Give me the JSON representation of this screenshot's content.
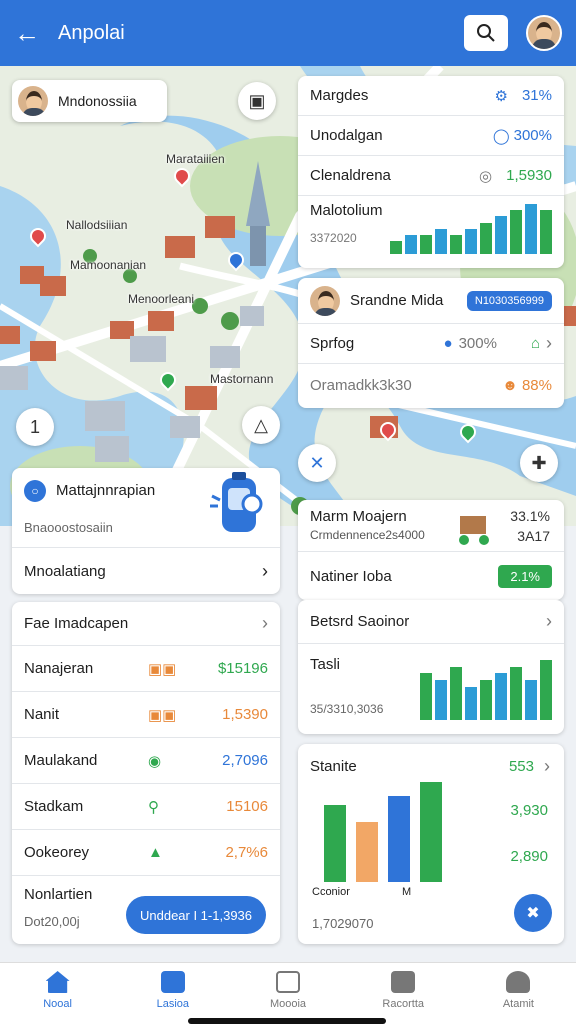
{
  "header": {
    "title": "Anpolai"
  },
  "location_chip": {
    "name": "Mndonossiia"
  },
  "map": {
    "labels": [
      "Marataiiien",
      "Nallodsiiian",
      "Mamoonanian",
      "Menoorleani",
      "Mastornann"
    ],
    "badge_left": "1"
  },
  "stats_card": {
    "rows": [
      {
        "label": "Margdes",
        "value": "31%"
      },
      {
        "label": "Unodalgan",
        "value": "300%"
      },
      {
        "label": "Clenaldrena",
        "value": "1,5930"
      },
      {
        "label": "Malotolium",
        "sub": "3372020"
      }
    ]
  },
  "profile_card": {
    "name": "Srandne Mida",
    "pill": "N1030356999",
    "row1_label": "Sprfog",
    "row1_value": "300%",
    "row2_label": "Oramadkk3k30",
    "row2_value": "88%"
  },
  "route_card": {
    "title": "Mattajnnrapian",
    "subtitle": "Bnaooostosaiin",
    "action": "Mnoalatiang"
  },
  "mid_card": {
    "title": "Marm Moajern",
    "sub": "Crmdennence2s4000",
    "v1": "33.1%",
    "v2": "3A17",
    "row_label": "Natiner Ioba",
    "row_badge": "2.1%"
  },
  "list_card": {
    "header": "Fae Imadcapen",
    "items": [
      {
        "label": "Nanajeran",
        "value": "$15196"
      },
      {
        "label": "Nanit",
        "value": "1,5390"
      },
      {
        "label": "Maulakand",
        "value": "2,7096"
      },
      {
        "label": "Stadkam",
        "value": "15106"
      },
      {
        "label": "Ookeorey",
        "value": "2,7%6"
      }
    ],
    "footer_label": "Nonlartien",
    "footer_sub": "Dot20,00j",
    "footer_button": "Unddear I 1-1,3936"
  },
  "sector_card": {
    "title": "Betsrd Saoinor",
    "label": "Tasli",
    "sub": "35/3310,3036"
  },
  "statis_card": {
    "title": "Stanite",
    "count": "553",
    "v1": "3,930",
    "v2": "2,890",
    "legend1": "Cconior",
    "legend2": "M",
    "footer": "1,7029070"
  },
  "nav": [
    {
      "label": "Nooal"
    },
    {
      "label": "Lasioa"
    },
    {
      "label": "Moooia"
    },
    {
      "label": "Racortta"
    },
    {
      "label": "Atamit"
    }
  ],
  "chart_data": [
    {
      "type": "bar",
      "values": [
        2,
        3,
        3,
        4,
        3,
        4,
        5,
        6,
        7,
        8,
        7
      ],
      "colors": [
        "#2fa84f",
        "#2c9cd6"
      ]
    },
    {
      "type": "bar",
      "values": [
        7,
        6,
        8,
        5,
        6,
        7,
        8,
        6,
        9
      ],
      "colors": [
        "#2fa84f",
        "#2c9cd6"
      ]
    },
    {
      "type": "bar",
      "values": [
        3.3,
        2.6,
        3.7,
        4.3
      ],
      "colors": [
        "#2fa84f",
        "#f2a766",
        "#2f74d8"
      ]
    }
  ]
}
